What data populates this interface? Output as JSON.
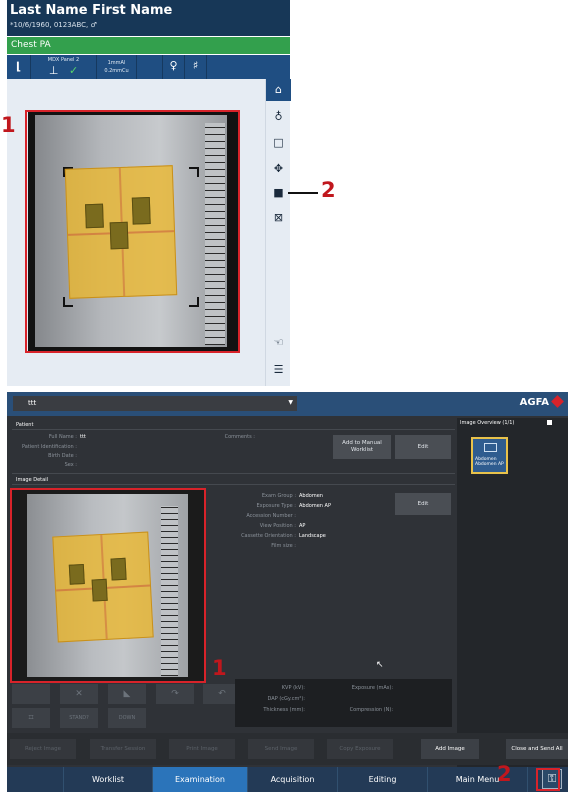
{
  "top_panel": {
    "patient_name": "Last Name First Name",
    "patient_info": "*10/6/1960, 0123ABC, ♂",
    "exam": "Chest PA",
    "toolbar": {
      "detector_label": "MDX Panel 2",
      "filter_line1": "1mmAl",
      "filter_line2": "0.2mmCu"
    },
    "callouts": {
      "image": "1",
      "camera": "2"
    }
  },
  "bottom_panel": {
    "patient_dropdown": "ttt",
    "brand": "AGFA",
    "patient_section": "Patient",
    "patient_fields": [
      {
        "label": "Full Name :",
        "value": "ttt"
      },
      {
        "label": "Patient Identification :",
        "value": ""
      },
      {
        "label": "Birth Date :",
        "value": ""
      },
      {
        "label": "Sex :",
        "value": ""
      }
    ],
    "comments_label": "Comments :",
    "add_manual_worklist": "Add to Manual Worklist",
    "edit_label": "Edit",
    "image_detail_section": "Image Detail",
    "image_fields": [
      {
        "label": "Exam Group :",
        "value": "Abdomen"
      },
      {
        "label": "Exposure Type :",
        "value": "Abdomen AP"
      },
      {
        "label": "Accession Number :",
        "value": ""
      },
      {
        "label": "View Position :",
        "value": "AP"
      },
      {
        "label": "Cassette Orientation :",
        "value": "Landscape"
      },
      {
        "label": "Film size :",
        "value": ""
      }
    ],
    "image_overview": {
      "title": "Image Overview (1/1)",
      "thumb_line1": "Abdomen",
      "thumb_line2": "Abdomen AP"
    },
    "tool_buttons": {
      "stand": "STAND?",
      "down": "DOWN"
    },
    "exposure_info": {
      "kvp": "KVP (kV):",
      "dap": "DAP (cGy.cm²):",
      "thickness": "Thickness (mm):",
      "exposure": "Exposure (mAs):",
      "compression": "Compression (N):"
    },
    "actions": [
      "Reject Image",
      "Transfer Session",
      "Print Image",
      "Send Image",
      "Copy Exposure",
      "Add Image",
      "Close and Send All"
    ],
    "nav_tabs": [
      "Worklist",
      "Examination",
      "Acquisition",
      "Editing",
      "Main Menu"
    ],
    "active_tab": "Examination",
    "callouts": {
      "image": "1",
      "lock": "2"
    }
  }
}
